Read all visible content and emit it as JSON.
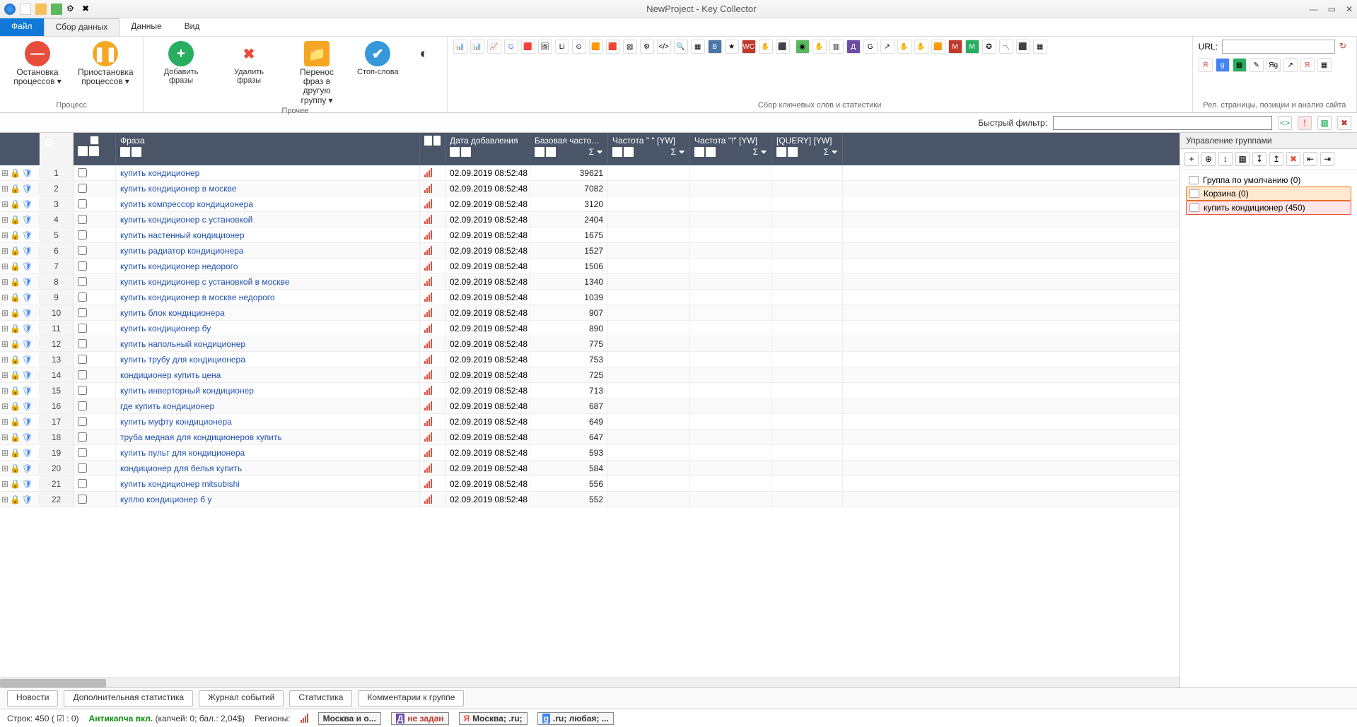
{
  "window": {
    "title": "NewProject - Key Collector"
  },
  "menu": {
    "file": "Файл",
    "collect": "Сбор данных",
    "data": "Данные",
    "view": "Вид"
  },
  "ribbon": {
    "stop": "Остановка процессов",
    "stopdrop": "▾",
    "pause": "Приостановка процессов",
    "pausedrop": "▾",
    "group1": "Процесс",
    "add": "Добавить фразы",
    "del": "Удалить фразы",
    "move": "Перенос фраз в другую группу",
    "movedrop": "▾",
    "stopwords": "Стоп-слова",
    "group2": "Прочее",
    "group3": "Сбор ключевых слов и статистики",
    "urlLabel": "URL:",
    "group4": "Рел. страницы, позиции и анализ сайта"
  },
  "filter": {
    "label": "Быстрый фильтр:"
  },
  "columns": {
    "phrase": "Фраза",
    "date": "Дата добавления",
    "base": "Базовая частота [YW]",
    "quote": "Частота \" \" [YW]",
    "excl": "Частота \"!\" [YW]",
    "query": "[QUERY] [YW]"
  },
  "rows": [
    {
      "n": 1,
      "phrase": "купить кондиционер",
      "date": "02.09.2019 08:52:48",
      "base": 39621
    },
    {
      "n": 2,
      "phrase": "купить кондиционер в москве",
      "date": "02.09.2019 08:52:48",
      "base": 7082
    },
    {
      "n": 3,
      "phrase": "купить компрессор кондиционера",
      "date": "02.09.2019 08:52:48",
      "base": 3120
    },
    {
      "n": 4,
      "phrase": "купить кондиционер с установкой",
      "date": "02.09.2019 08:52:48",
      "base": 2404
    },
    {
      "n": 5,
      "phrase": "купить настенный кондиционер",
      "date": "02.09.2019 08:52:48",
      "base": 1675
    },
    {
      "n": 6,
      "phrase": "купить радиатор кондиционера",
      "date": "02.09.2019 08:52:48",
      "base": 1527
    },
    {
      "n": 7,
      "phrase": "купить кондиционер недорого",
      "date": "02.09.2019 08:52:48",
      "base": 1506
    },
    {
      "n": 8,
      "phrase": "купить кондиционер с установкой в москве",
      "date": "02.09.2019 08:52:48",
      "base": 1340
    },
    {
      "n": 9,
      "phrase": "купить кондиционер в москве недорого",
      "date": "02.09.2019 08:52:48",
      "base": 1039
    },
    {
      "n": 10,
      "phrase": "купить блок кондиционера",
      "date": "02.09.2019 08:52:48",
      "base": 907
    },
    {
      "n": 11,
      "phrase": "купить кондиционер бу",
      "date": "02.09.2019 08:52:48",
      "base": 890
    },
    {
      "n": 12,
      "phrase": "купить напольный кондиционер",
      "date": "02.09.2019 08:52:48",
      "base": 775
    },
    {
      "n": 13,
      "phrase": "купить трубу для кондиционера",
      "date": "02.09.2019 08:52:48",
      "base": 753
    },
    {
      "n": 14,
      "phrase": "кондиционер купить цена",
      "date": "02.09.2019 08:52:48",
      "base": 725
    },
    {
      "n": 15,
      "phrase": "купить инверторный кондиционер",
      "date": "02.09.2019 08:52:48",
      "base": 713
    },
    {
      "n": 16,
      "phrase": "где купить кондиционер",
      "date": "02.09.2019 08:52:48",
      "base": 687
    },
    {
      "n": 17,
      "phrase": "купить муфту кондиционера",
      "date": "02.09.2019 08:52:48",
      "base": 649
    },
    {
      "n": 18,
      "phrase": "труба медная для кондиционеров купить",
      "date": "02.09.2019 08:52:48",
      "base": 647
    },
    {
      "n": 19,
      "phrase": "купить пульт для кондиционера",
      "date": "02.09.2019 08:52:48",
      "base": 593
    },
    {
      "n": 20,
      "phrase": "кондиционер для белья купить",
      "date": "02.09.2019 08:52:48",
      "base": 584
    },
    {
      "n": 21,
      "phrase": "купить кондиционер mitsubishi",
      "date": "02.09.2019 08:52:48",
      "base": 556
    },
    {
      "n": 22,
      "phrase": "куплю кондиционер б у",
      "date": "02.09.2019 08:52:48",
      "base": 552
    }
  ],
  "side": {
    "header": "Управление группами",
    "group_default": "Группа по умолчанию (0)",
    "group_trash": "Корзина (0)",
    "group_sel": "купить кондиционер (450)"
  },
  "bottomTabs": {
    "news": "Новости",
    "stats2": "Дополнительная статистика",
    "log": "Журнал событий",
    "stats": "Статистика",
    "comments": "Комментарии к группе"
  },
  "status": {
    "rows": "Строк: 450 ( ☑ : 0)",
    "anti": "Антикапча вкл.",
    "anti2": "(капчей: 0; бал.: 2,04$)",
    "regions": "Регионы:",
    "r1": "Москва и о...",
    "r2": "не задан",
    "r3": "Москва; .ru;",
    "r4": ".ru; любая; ..."
  }
}
